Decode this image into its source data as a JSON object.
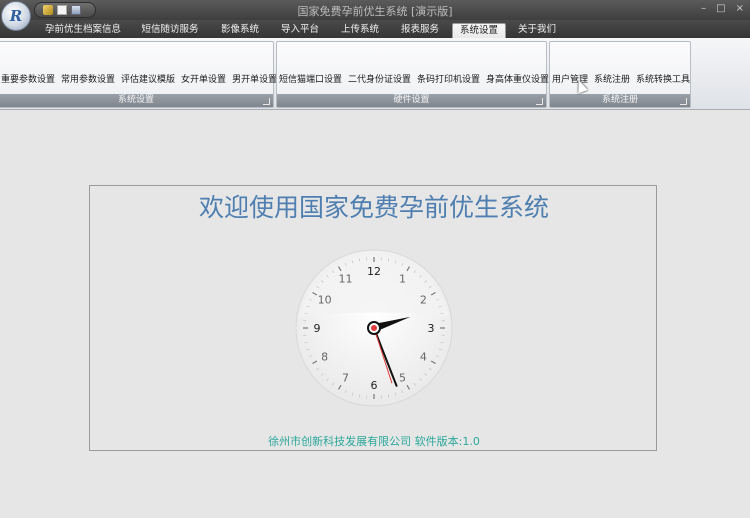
{
  "window": {
    "title": "国家免费孕前优生系统 [演示版]",
    "logo_text": "R",
    "controls": [
      "–",
      "□",
      "×"
    ]
  },
  "quick_access": [
    "key-icon",
    "document-icon",
    "print-icon"
  ],
  "tabs": [
    {
      "label": "孕前优生档案信息"
    },
    {
      "label": "短信随访服务"
    },
    {
      "label": "影像系统"
    },
    {
      "label": "导入平台"
    },
    {
      "label": "上传系统"
    },
    {
      "label": "报表服务"
    },
    {
      "label": "系统设置",
      "active": true
    },
    {
      "label": "关于我们"
    }
  ],
  "ribbon": {
    "groups": [
      {
        "label": "系统设置",
        "items": [
          "重要参数设置",
          "常用参数设置",
          "评估建议模版",
          "女开单设置",
          "男开单设置"
        ]
      },
      {
        "label": "硬件设置",
        "items": [
          "短信猫端口设置",
          "二代身份证设置",
          "条码打印机设置",
          "身高体重仪设置"
        ]
      },
      {
        "label": "系统注册",
        "items": [
          "用户管理",
          "系统注册",
          "系统转换工具"
        ]
      }
    ]
  },
  "main": {
    "welcome": "欢迎使用国家免费孕前优生系统",
    "company": "徐州市创新科技发展有限公司 软件版本:1.0",
    "clock": {
      "numbers": [
        "12",
        "1",
        "2",
        "3",
        "4",
        "5",
        "6",
        "7",
        "8",
        "9",
        "10",
        "11"
      ],
      "hour": 2,
      "minute": 26,
      "second": 27
    }
  },
  "colors": {
    "accent": "#4f7fb0",
    "company_text": "#2aa79a",
    "second_hand": "#e23b3b"
  }
}
